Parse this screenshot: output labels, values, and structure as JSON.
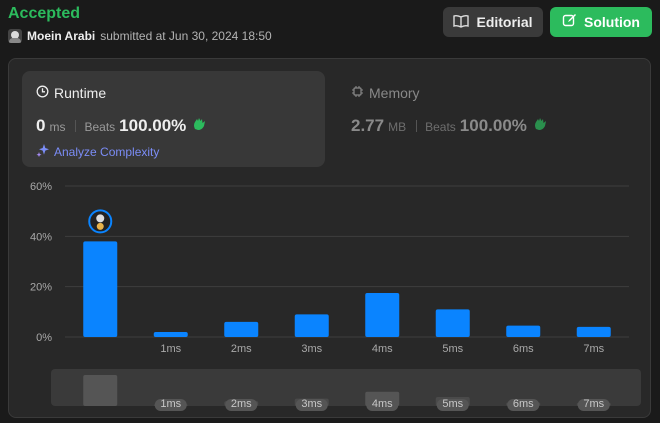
{
  "header": {
    "status": "Accepted",
    "submitter_name": "Moein Arabi",
    "submitted_text": "submitted at Jun 30, 2024 18:50",
    "editorial_label": "Editorial",
    "solution_label": "Solution"
  },
  "runtime": {
    "title": "Runtime",
    "value": "0",
    "unit": "ms",
    "beats_label": "Beats",
    "beats_value": "100.00%",
    "analyze_label": "Analyze Complexity"
  },
  "memory": {
    "title": "Memory",
    "value": "2.77",
    "unit": "MB",
    "beats_label": "Beats",
    "beats_value": "100.00%"
  },
  "colors": {
    "accent_green": "#2cbb5d",
    "bar_blue": "#0a84ff",
    "analyze_purple": "#7b8df7"
  },
  "icons": {
    "editorial": "book-icon",
    "solution": "edit-icon",
    "runtime": "clock-icon",
    "memory": "chip-icon",
    "analyze": "sparkle-icon",
    "beats": "clapping-hands-icon"
  },
  "chart_data": {
    "type": "bar",
    "categories": [
      "",
      "1ms",
      "2ms",
      "3ms",
      "4ms",
      "5ms",
      "6ms",
      "7ms"
    ],
    "values": [
      38,
      2,
      6,
      9,
      17.5,
      11,
      4.5,
      4
    ],
    "yticks": [
      "60%",
      "40%",
      "20%",
      "0%"
    ],
    "ylim": [
      0,
      60
    ],
    "grid": true,
    "highlighted_index": 0,
    "brush_labels": [
      "1ms",
      "2ms",
      "3ms",
      "4ms",
      "5ms",
      "6ms",
      "7ms"
    ]
  }
}
